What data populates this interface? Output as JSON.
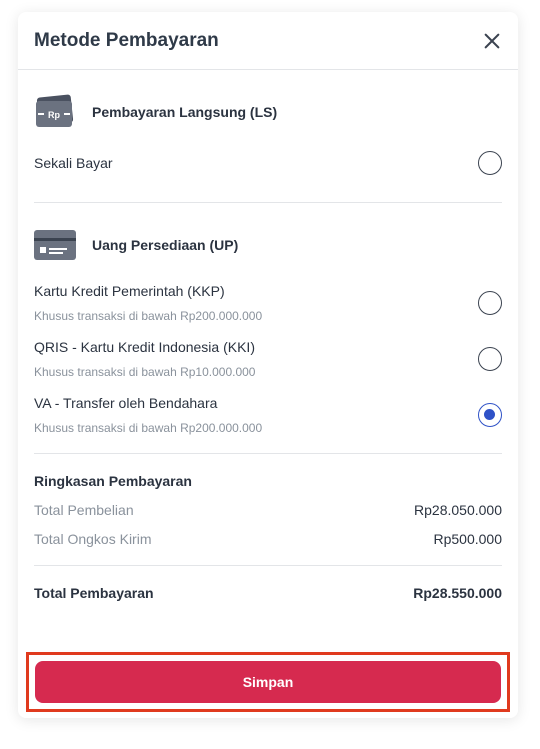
{
  "modal": {
    "title": "Metode Pembayaran"
  },
  "ls": {
    "icon_text": "Rp",
    "title": "Pembayaran Langsung (LS)",
    "options": [
      {
        "label": "Sekali Bayar",
        "selected": false
      }
    ]
  },
  "up": {
    "title": "Uang Persediaan (UP)",
    "options": [
      {
        "label": "Kartu Kredit Pemerintah (KKP)",
        "note": "Khusus transaksi di bawah Rp200.000.000",
        "selected": false
      },
      {
        "label": "QRIS - Kartu Kredit Indonesia (KKI)",
        "note": "Khusus transaksi di bawah Rp10.000.000",
        "selected": false
      },
      {
        "label": "VA - Transfer oleh Bendahara",
        "note": "Khusus transaksi di bawah Rp200.000.000",
        "selected": true
      }
    ]
  },
  "summary": {
    "title": "Ringkasan Pembayaran",
    "rows": [
      {
        "label": "Total Pembelian",
        "value": "Rp28.050.000"
      },
      {
        "label": "Total Ongkos Kirim",
        "value": "Rp500.000"
      }
    ],
    "total_label": "Total Pembayaran",
    "total_value": "Rp28.550.000"
  },
  "actions": {
    "save_label": "Simpan"
  },
  "colors": {
    "accent": "#d62a4f",
    "radio_selected": "#2f52c7",
    "highlight_border": "#e03a1e"
  }
}
